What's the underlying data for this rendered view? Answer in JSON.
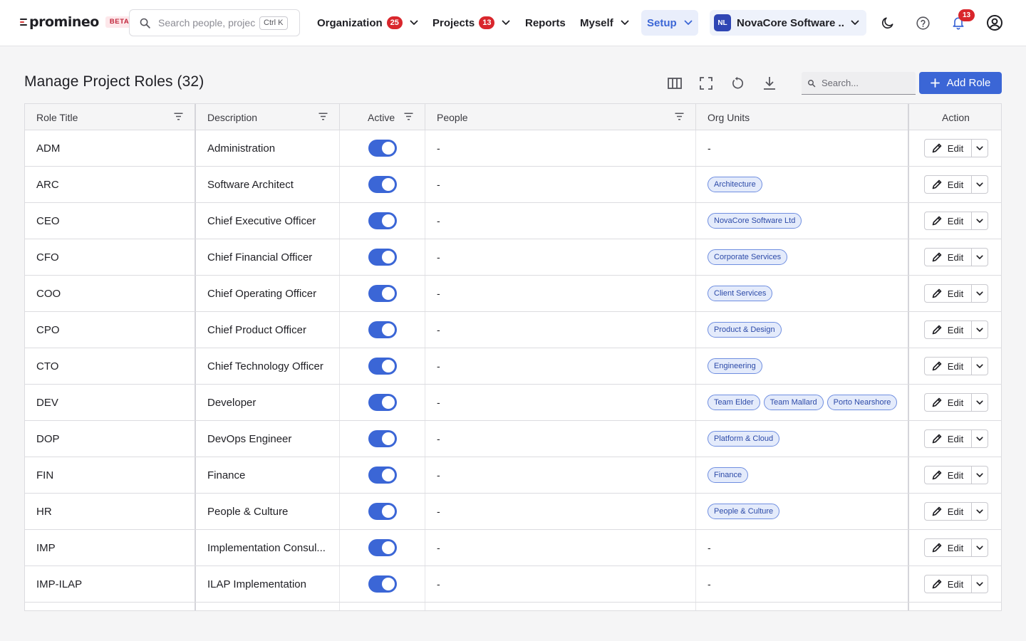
{
  "brand": {
    "name": "promineo",
    "badge": "BETA"
  },
  "search": {
    "placeholder": "Search people, projects",
    "shortcut": "Ctrl K"
  },
  "nav": {
    "organization": {
      "label": "Organization",
      "count": "25"
    },
    "projects": {
      "label": "Projects",
      "count": "13"
    },
    "reports": {
      "label": "Reports"
    },
    "myself": {
      "label": "Myself"
    },
    "setup": {
      "label": "Setup"
    }
  },
  "org": {
    "initials": "NL",
    "name": "NovaCore Software ..."
  },
  "notifications": {
    "count": "13"
  },
  "page": {
    "title": "Manage Project Roles (32)",
    "search_placeholder": "Search...",
    "add_label": "Add Role"
  },
  "table": {
    "columns": {
      "role_title": "Role Title",
      "description": "Description",
      "active": "Active",
      "people": "People",
      "org_units": "Org Units",
      "action": "Action"
    },
    "edit_label": "Edit",
    "rows": [
      {
        "title": "ADM",
        "description": "Administration",
        "active": true,
        "people": "-",
        "org_units_text": "-",
        "org_units": []
      },
      {
        "title": "ARC",
        "description": "Software Architect",
        "active": true,
        "people": "-",
        "org_units_text": "",
        "org_units": [
          "Architecture"
        ]
      },
      {
        "title": "CEO",
        "description": "Chief Executive Officer",
        "active": true,
        "people": "-",
        "org_units_text": "",
        "org_units": [
          "NovaCore Software Ltd"
        ]
      },
      {
        "title": "CFO",
        "description": "Chief Financial Officer",
        "active": true,
        "people": "-",
        "org_units_text": "",
        "org_units": [
          "Corporate Services"
        ]
      },
      {
        "title": "COO",
        "description": "Chief Operating Officer",
        "active": true,
        "people": "-",
        "org_units_text": "",
        "org_units": [
          "Client Services"
        ]
      },
      {
        "title": "CPO",
        "description": "Chief Product Officer",
        "active": true,
        "people": "-",
        "org_units_text": "",
        "org_units": [
          "Product & Design"
        ]
      },
      {
        "title": "CTO",
        "description": "Chief Technology Officer",
        "active": true,
        "people": "-",
        "org_units_text": "",
        "org_units": [
          "Engineering"
        ]
      },
      {
        "title": "DEV",
        "description": "Developer",
        "active": true,
        "people": "-",
        "org_units_text": "",
        "org_units": [
          "Team Elder",
          "Team Mallard",
          "Porto Nearshore"
        ]
      },
      {
        "title": "DOP",
        "description": "DevOps Engineer",
        "active": true,
        "people": "-",
        "org_units_text": "",
        "org_units": [
          "Platform & Cloud"
        ]
      },
      {
        "title": "FIN",
        "description": "Finance",
        "active": true,
        "people": "-",
        "org_units_text": "",
        "org_units": [
          "Finance"
        ]
      },
      {
        "title": "HR",
        "description": "People & Culture",
        "active": true,
        "people": "-",
        "org_units_text": "",
        "org_units": [
          "People & Culture"
        ]
      },
      {
        "title": "IMP",
        "description": "Implementation Consul...",
        "active": true,
        "people": "-",
        "org_units_text": "-",
        "org_units": []
      },
      {
        "title": "IMP-ILAP",
        "description": "ILAP Implementation",
        "active": true,
        "people": "-",
        "org_units_text": "-",
        "org_units": []
      }
    ]
  },
  "colors": {
    "accent": "#3b66d6",
    "badge": "#d9262c",
    "brand_red": "#d63a3a"
  }
}
